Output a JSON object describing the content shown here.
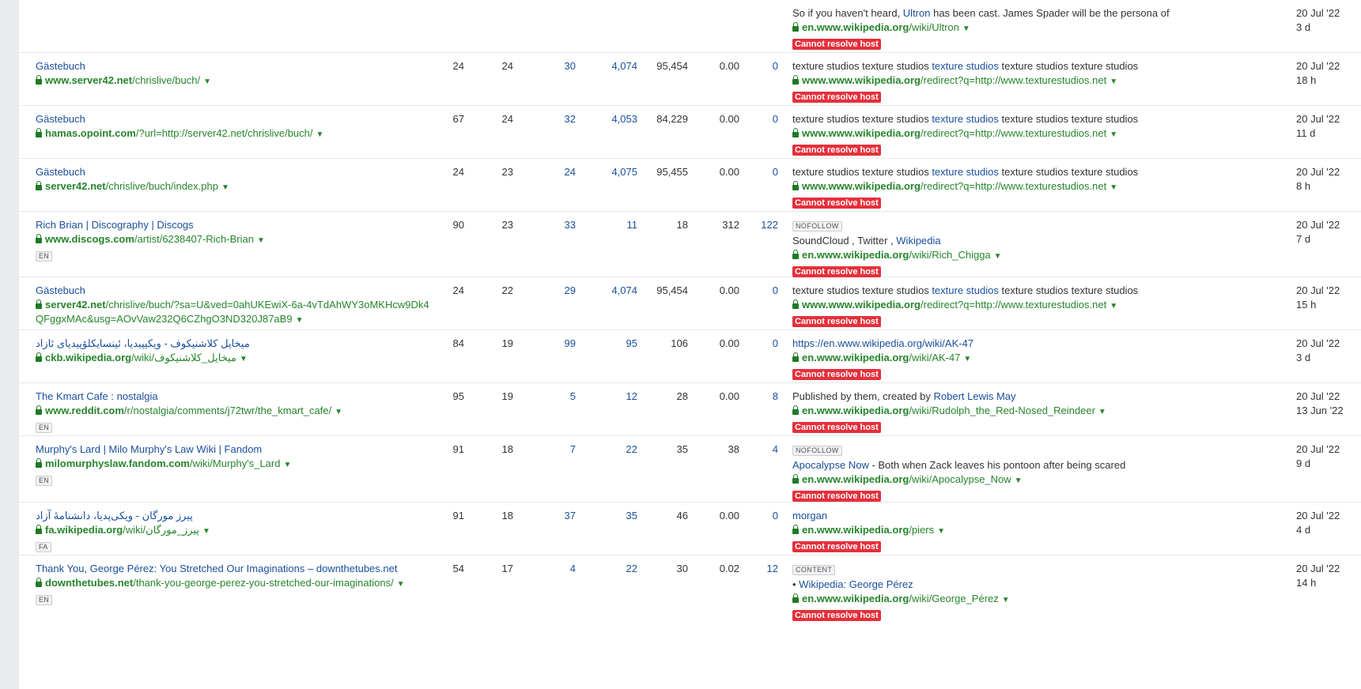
{
  "rows": [
    {
      "title": "",
      "url_host": "",
      "url_path": "",
      "lang": "",
      "dr": "",
      "ur": "",
      "domains": "",
      "linked": "",
      "ext": "",
      "traffic": "",
      "kw": "",
      "tag": "",
      "anchor_before": "So if you haven't heard, ",
      "anchor_link": "Ultron",
      "anchor_after": " has been cast. James Spader will be the persona of",
      "target_host": "en.www.wikipedia.org",
      "target_path": "/wiki/Ultron",
      "error": "Cannot resolve host",
      "date_first": "20 Jul '22",
      "date_second": "3 d"
    },
    {
      "title": "Gästebuch",
      "url_host": "www.server42.net",
      "url_path": "/chrislive/buch/",
      "lang": "",
      "dr": "24",
      "ur": "24",
      "domains": "30",
      "linked": "4,074",
      "ext": "95,454",
      "traffic": "0.00",
      "kw": "0",
      "tag": "",
      "anchor_before": "texture studios texture studios ",
      "anchor_link": "texture studios",
      "anchor_after": " texture studios texture studios",
      "target_host": "www.www.wikipedia.org",
      "target_path": "/redirect?q=http://www.texturestudios.net",
      "error": "Cannot resolve host",
      "date_first": "20 Jul '22",
      "date_second": "18 h"
    },
    {
      "title": "Gästebuch",
      "url_host": "hamas.opoint.com",
      "url_path": "/?url=http://server42.net/chrislive/buch/",
      "lang": "",
      "dr": "67",
      "ur": "24",
      "domains": "32",
      "linked": "4,053",
      "ext": "84,229",
      "traffic": "0.00",
      "kw": "0",
      "tag": "",
      "anchor_before": "texture studios texture studios ",
      "anchor_link": "texture studios",
      "anchor_after": " texture studios texture studios",
      "target_host": "www.www.wikipedia.org",
      "target_path": "/redirect?q=http://www.texturestudios.net",
      "error": "Cannot resolve host",
      "date_first": "20 Jul '22",
      "date_second": "11 d"
    },
    {
      "title": "Gästebuch",
      "url_host": "server42.net",
      "url_path": "/chrislive/buch/index.php",
      "lang": "",
      "dr": "24",
      "ur": "23",
      "domains": "24",
      "linked": "4,075",
      "ext": "95,455",
      "traffic": "0.00",
      "kw": "0",
      "tag": "",
      "anchor_before": "texture studios texture studios ",
      "anchor_link": "texture studios",
      "anchor_after": " texture studios texture studios",
      "target_host": "www.www.wikipedia.org",
      "target_path": "/redirect?q=http://www.texturestudios.net",
      "error": "Cannot resolve host",
      "date_first": "20 Jul '22",
      "date_second": "8 h"
    },
    {
      "title": "Rich Brian | Discography | Discogs",
      "url_host": "www.discogs.com",
      "url_path": "/artist/6238407-Rich-Brian",
      "lang": "EN",
      "dr": "90",
      "ur": "23",
      "domains": "33",
      "linked": "11",
      "ext": "18",
      "traffic": "312",
      "kw": "122",
      "tag": "NOFOLLOW",
      "anchor_before": "SoundCloud , Twitter , ",
      "anchor_link": "Wikipedia",
      "anchor_after": "",
      "target_host": "en.www.wikipedia.org",
      "target_path": "/wiki/Rich_Chigga",
      "error": "Cannot resolve host",
      "date_first": "20 Jul '22",
      "date_second": "7 d"
    },
    {
      "title": "Gästebuch",
      "url_host": "server42.net",
      "url_path": "/chrislive/buch/?sa=U&ved=0ahUKEwiX-6a-4vTdAhWY3oMKHcw9Dk4QFggxMAc&usg=AOvVaw232Q6CZhgO3ND320J87aB9",
      "lang": "",
      "dr": "24",
      "ur": "22",
      "domains": "29",
      "linked": "4,074",
      "ext": "95,454",
      "traffic": "0.00",
      "kw": "0",
      "tag": "",
      "anchor_before": "texture studios texture studios ",
      "anchor_link": "texture studios",
      "anchor_after": " texture studios texture studios",
      "target_host": "www.www.wikipedia.org",
      "target_path": "/redirect?q=http://www.texturestudios.net",
      "error": "Cannot resolve host",
      "date_first": "20 Jul '22",
      "date_second": "15 h"
    },
    {
      "title": "میخایل کلاشنیکوف - ویکیپیدیا، ئینسایکلۆپیدیای ئازاد",
      "url_host": "ckb.wikipedia.org",
      "url_path": "/wiki/میخایل_کلاشنیکوف",
      "lang": "",
      "dr": "84",
      "ur": "19",
      "domains": "99",
      "linked": "95",
      "ext": "106",
      "traffic": "0.00",
      "kw": "0",
      "tag": "",
      "anchor_before": "",
      "anchor_link": "https://en.www.wikipedia.org/wiki/AK-47",
      "anchor_after": "",
      "target_host": "en.www.wikipedia.org",
      "target_path": "/wiki/AK-47",
      "error": "Cannot resolve host",
      "date_first": "20 Jul '22",
      "date_second": "3 d"
    },
    {
      "title": "The Kmart Cafe : nostalgia",
      "url_host": "www.reddit.com",
      "url_path": "/r/nostalgia/comments/j72twr/the_kmart_cafe/",
      "lang": "EN",
      "dr": "95",
      "ur": "19",
      "domains": "5",
      "linked": "12",
      "ext": "28",
      "traffic": "0.00",
      "kw": "8",
      "tag": "",
      "anchor_before": "Published by them, created by ",
      "anchor_link": "Robert Lewis May",
      "anchor_after": "",
      "target_host": "en.www.wikipedia.org",
      "target_path": "/wiki/Rudolph_the_Red-Nosed_Reindeer",
      "error": "Cannot resolve host",
      "date_first": "20 Jul '22",
      "date_second": "13 Jun '22"
    },
    {
      "title": "Murphy's Lard | Milo Murphy's Law Wiki | Fandom",
      "url_host": "milomurphyslaw.fandom.com",
      "url_path": "/wiki/Murphy's_Lard",
      "lang": "EN",
      "dr": "91",
      "ur": "18",
      "domains": "7",
      "linked": "22",
      "ext": "35",
      "traffic": "38",
      "kw": "4",
      "tag": "NOFOLLOW",
      "anchor_before": "",
      "anchor_link": "Apocalypse Now",
      "anchor_after": " - Both when Zack leaves his pontoon after being scared",
      "target_host": "en.www.wikipedia.org",
      "target_path": "/wiki/Apocalypse_Now",
      "error": "Cannot resolve host",
      "date_first": "20 Jul '22",
      "date_second": "9 d"
    },
    {
      "title": "پیرز مورگان - ویکی‌پدیا، دانشنامهٔ آزاد",
      "url_host": "fa.wikipedia.org",
      "url_path": "/wiki/پیرز_مورگان",
      "lang": "FA",
      "dr": "91",
      "ur": "18",
      "domains": "37",
      "linked": "35",
      "ext": "46",
      "traffic": "0.00",
      "kw": "0",
      "tag": "",
      "anchor_before": "",
      "anchor_link": "morgan",
      "anchor_after": "",
      "target_host": "en.www.wikipedia.org",
      "target_path": "/piers",
      "error": "Cannot resolve host",
      "date_first": "20 Jul '22",
      "date_second": "4 d"
    },
    {
      "title": "Thank You, George Pérez: You Stretched Our Imaginations – downthetubes.net",
      "url_host": "downthetubes.net",
      "url_path": "/thank-you-george-perez-you-stretched-our-imaginations/",
      "lang": "EN",
      "dr": "54",
      "ur": "17",
      "domains": "4",
      "linked": "22",
      "ext": "30",
      "traffic": "0.02",
      "kw": "12",
      "tag": "CONTENT",
      "anchor_before": "• ",
      "anchor_link": "Wikipedia: George Pérez",
      "anchor_after": "",
      "target_host": "en.www.wikipedia.org",
      "target_path": "/wiki/George_Pérez",
      "error": "Cannot resolve host",
      "date_first": "20 Jul '22",
      "date_second": "14 h"
    }
  ]
}
